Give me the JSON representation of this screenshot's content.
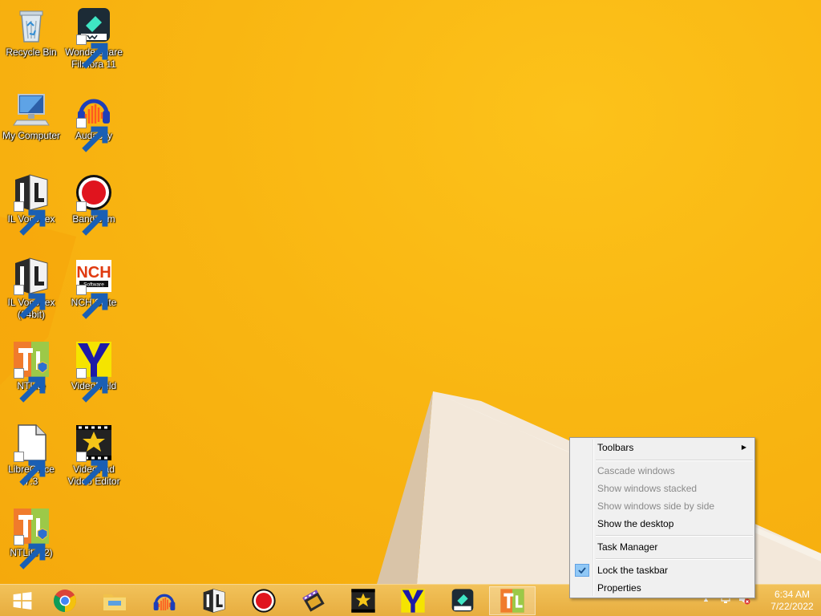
{
  "desktop": {
    "icons": [
      {
        "label": "Recycle Bin"
      },
      {
        "label": "Wondershare\nFilmora 11"
      },
      {
        "label": "My Computer"
      },
      {
        "label": "Audacity"
      },
      {
        "label": "IL Vocodex"
      },
      {
        "label": "Bandicam"
      },
      {
        "label": "IL Vocodex\n(64bit)"
      },
      {
        "label": "NCH Suite"
      },
      {
        "label": "NTLite"
      },
      {
        "label": "VideoMeld"
      },
      {
        "label": "LibreOffice\n7.3"
      },
      {
        "label": "VideoPad\nVideo Editor"
      },
      {
        "label": "NTLite (2)"
      }
    ],
    "nch_text": "NCH",
    "nch_sub": "Software"
  },
  "context_menu": {
    "toolbars": "Toolbars",
    "cascade": "Cascade windows",
    "stacked": "Show windows stacked",
    "side_by_side": "Show windows side by side",
    "show_desktop": "Show the desktop",
    "task_manager": "Task Manager",
    "lock_taskbar": "Lock the taskbar",
    "properties": "Properties"
  },
  "taskbar": {
    "time": "6:34 AM",
    "date": "7/22/2022"
  },
  "colors": {
    "wallpaper": "#f9b511",
    "taskbar": "#e9b046",
    "menu_bg": "#f0f0f0",
    "check_bg": "#90c8f6"
  }
}
